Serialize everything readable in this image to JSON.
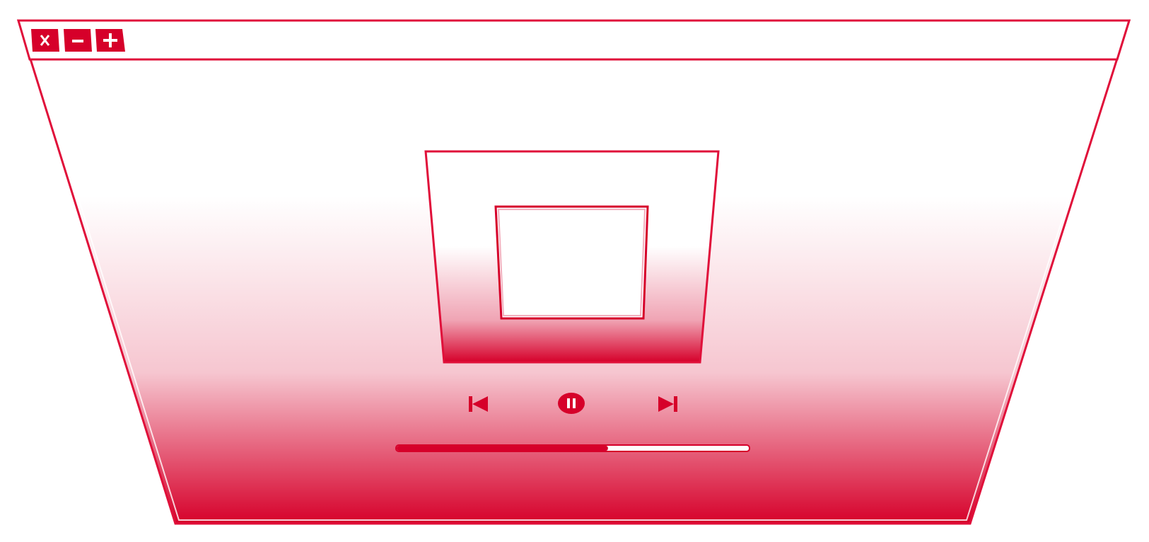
{
  "window": {
    "title_bar_buttons": [
      {
        "name": "close-button",
        "icon": "close-icon",
        "glyph": "x"
      },
      {
        "name": "minimize-button",
        "icon": "minus-icon",
        "glyph": "minus"
      },
      {
        "name": "maximize-button",
        "icon": "plus-icon",
        "glyph": "plus"
      }
    ]
  },
  "player": {
    "album_art": "album-art-placeholder",
    "controls": [
      {
        "name": "previous-button",
        "icon": "skip-previous-icon"
      },
      {
        "name": "pause-button",
        "icon": "pause-icon"
      },
      {
        "name": "next-button",
        "icon": "skip-next-icon"
      }
    ],
    "progress_fraction": 0.6
  },
  "colors": {
    "accent": "#d6002a",
    "background": "#ffffff",
    "border": "#e0103a"
  }
}
